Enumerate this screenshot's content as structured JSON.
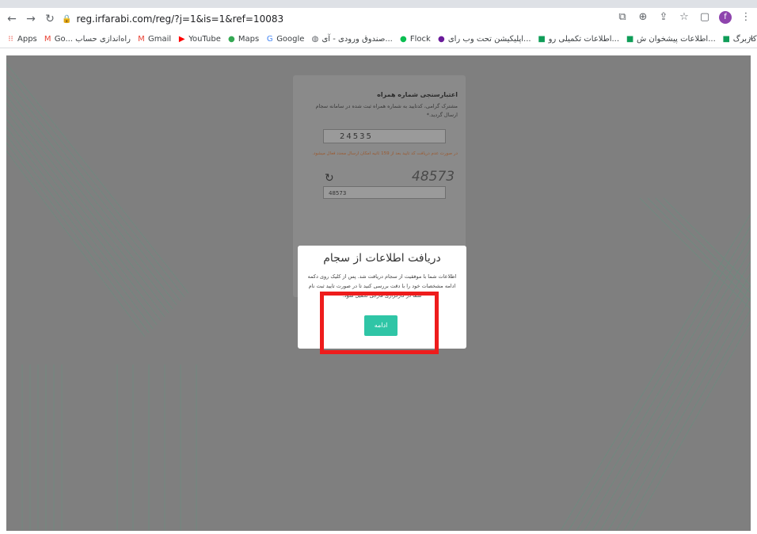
{
  "browser": {
    "url": "reg.irfarabi.com/reg/?j=1&is=1&ref=10083",
    "profile_initial": "f"
  },
  "bookmarks": [
    {
      "label": "Apps",
      "icon": "apps-grid-icon",
      "color": "#ea4335"
    },
    {
      "label": "Go... راه‌اندازی حساب",
      "icon": "gmail-icon",
      "color": "#ea4335"
    },
    {
      "label": "Gmail",
      "icon": "gmail-icon",
      "color": "#ea4335"
    },
    {
      "label": "YouTube",
      "icon": "youtube-icon",
      "color": "#ff0000"
    },
    {
      "label": "Maps",
      "icon": "maps-pin-icon",
      "color": "#34a853"
    },
    {
      "label": "Google",
      "icon": "google-icon",
      "color": "#4285f4"
    },
    {
      "label": "صندوق ورودی - آی...",
      "icon": "globe-icon",
      "color": "#5f6368"
    },
    {
      "label": "Flock",
      "icon": "flock-icon",
      "color": "#0abe51"
    },
    {
      "label": "اپلیکیشن تحت وب رای...",
      "icon": "app-icon",
      "color": "#6a1b9a"
    },
    {
      "label": "اطلاعات تکمیلی رو...",
      "icon": "doc-plus-icon",
      "color": "#0f9d58"
    },
    {
      "label": "اطلاعات پیشخوان ش...",
      "icon": "doc-plus-icon",
      "color": "#0f9d58"
    },
    {
      "label": "دفاتر شهری - کاربرگ...",
      "icon": "doc-plus-icon",
      "color": "#0f9d58"
    }
  ],
  "verify_card": {
    "title": "اعتبارسنجی شماره همراه",
    "description": "مشترک گرامی، کدتایید به شماره همراه ثبت شده در سامانه سجام ارسال گردید.*",
    "code_value": "24535",
    "warning": "در صورت عدم دریافت کد تایید بعد از 159 ثانیه امکان ارسال مجدد فعال میشود.",
    "captcha_text": "48573",
    "captcha_input_value": "48573"
  },
  "modal": {
    "title": "دریافت اطلاعات از سجام",
    "body": "اطلاعات شما با موفقیت از سجام دریافت شد. پس از کلیک روی دکمه ادامه مشخصات خود را با دقت بررسی کنید تا در صورت تایید ثبت نام شما در کارگزاری فارابی تکمیل شود.",
    "continue_label": "ادامه"
  }
}
